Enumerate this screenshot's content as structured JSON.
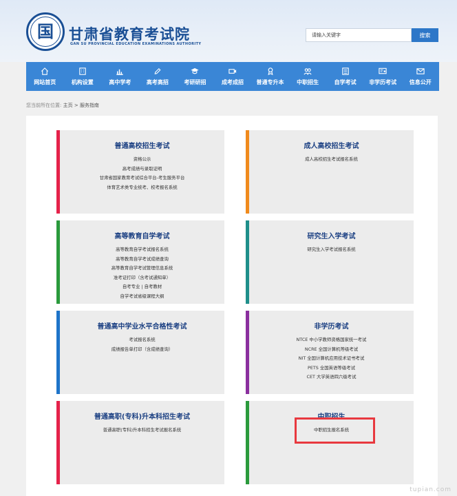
{
  "site": {
    "title": "甘肃省教育考试院",
    "subtitle": "GAN SU PROVINCIAL EDUCATION EXAMINATIONS AUTHORITY",
    "logo_char": "国"
  },
  "search": {
    "placeholder": "请输入关键字",
    "button_label": "搜索"
  },
  "nav": [
    {
      "label": "网站首页",
      "icon": "home-icon"
    },
    {
      "label": "机构设置",
      "icon": "building-icon"
    },
    {
      "label": "高中学考",
      "icon": "chart-icon"
    },
    {
      "label": "高考高招",
      "icon": "pencil-icon"
    },
    {
      "label": "考研研招",
      "icon": "graduation-cap-icon"
    },
    {
      "label": "成考成招",
      "icon": "video-icon"
    },
    {
      "label": "普通专升本",
      "icon": "badge-icon"
    },
    {
      "label": "中职招生",
      "icon": "users-icon"
    },
    {
      "label": "自学考试",
      "icon": "book-icon"
    },
    {
      "label": "非学历考试",
      "icon": "certificate-icon"
    },
    {
      "label": "信息公开",
      "icon": "mail-icon"
    }
  ],
  "breadcrumb": {
    "lead": "您当前所在位置:",
    "home": "主页",
    "separator": ">",
    "current": "服务指南"
  },
  "cards": [
    {
      "title": "普通高校招生考试",
      "accent": "#e5224a",
      "links": [
        "资格公示",
        "高考成绩与录取证明",
        "甘肃省国家教育考试综合平台-考生服务平台",
        "体育艺术类专业统考、校考报名系统"
      ]
    },
    {
      "title": "成人高校招生考试",
      "accent": "#f08a1c",
      "links": [
        "成人高校招生考试报名系统"
      ]
    },
    {
      "title": "高等教育自学考试",
      "accent": "#2a9a3c",
      "links": [
        "高等教育自学考试报名系统",
        "高等教育自学考试成绩查询",
        "高等教育自学考试管理信息系统",
        "准考证打印（含考试通知单）",
        "自考专业 | 自考教材",
        "自学考试省级课程大纲"
      ]
    },
    {
      "title": "研究生入学考试",
      "accent": "#1f8f8a",
      "links": [
        "研究生入学考试报名系统"
      ]
    },
    {
      "title": "普通高中学业水平合格性考试",
      "accent": "#1e74c9",
      "links": [
        "考试报名系统",
        "成绩报告单打印（含成绩查询）"
      ]
    },
    {
      "title": "非学历考试",
      "accent": "#8a2f9e",
      "links": [
        "NTCE 中小学教师资格国家统一考试",
        "NCRE 全国计算机等级考试",
        "NIT 全国计算机应用技术证书考试",
        "PETS 全国英语等级考试",
        "CET 大学英语四六级考试"
      ]
    },
    {
      "title": "普通高职(专科)升本科招生考试",
      "accent": "#e5224a",
      "links": [
        "普通高职(专科)升本科招生考试报名系统"
      ]
    },
    {
      "title": "中职招生",
      "accent": "#2a9a3c",
      "links": [
        "中职招生报名系统"
      ]
    }
  ],
  "watermark": "tupian.com"
}
